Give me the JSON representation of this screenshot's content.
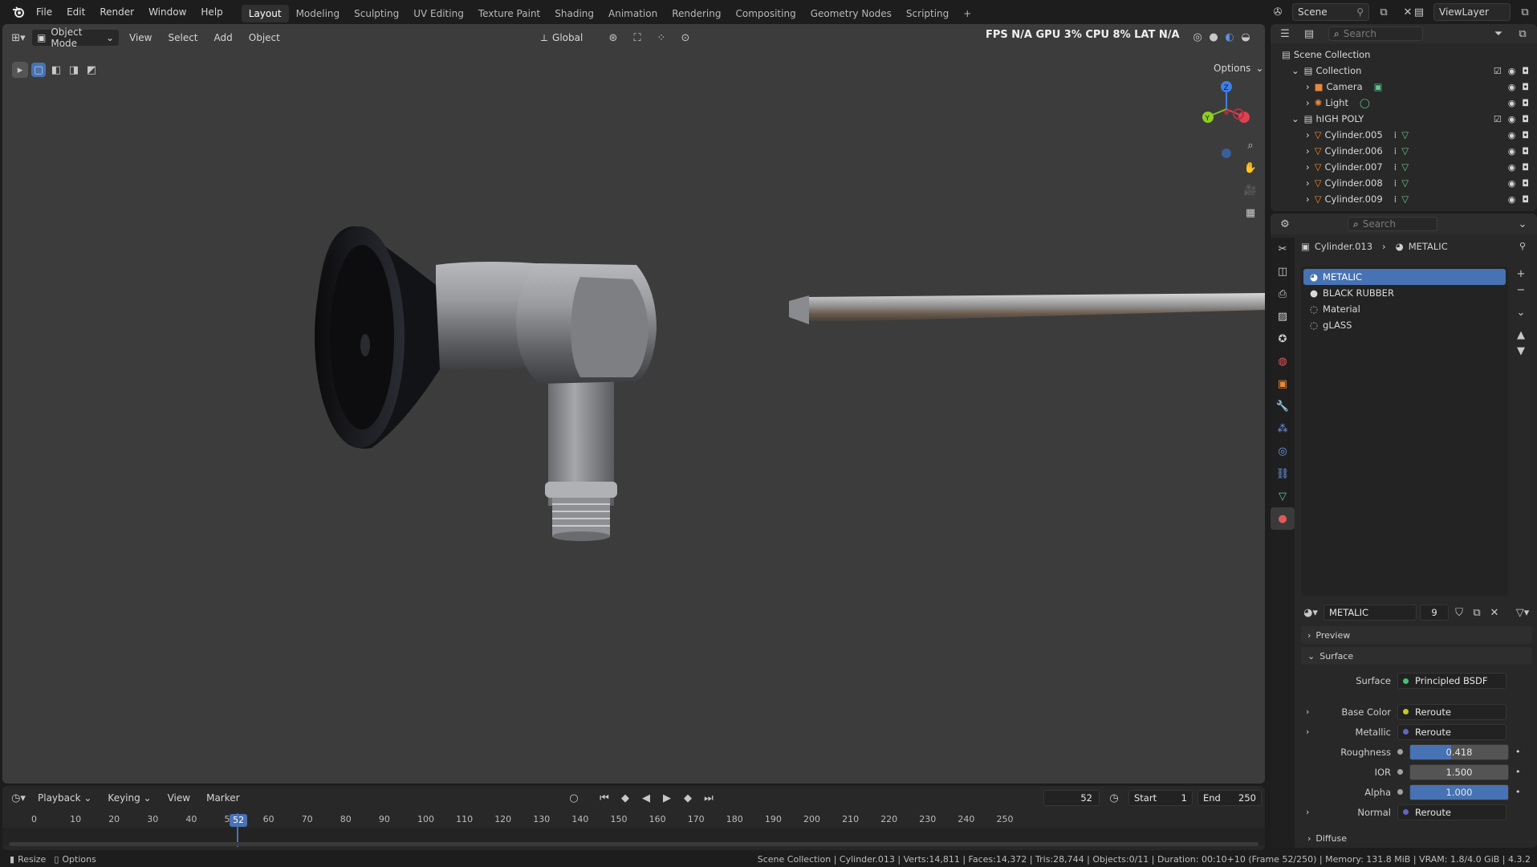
{
  "topbar": {
    "menus": [
      "File",
      "Edit",
      "Render",
      "Window",
      "Help"
    ],
    "workspaces": [
      "Layout",
      "Modeling",
      "Sculpting",
      "UV Editing",
      "Texture Paint",
      "Shading",
      "Animation",
      "Rendering",
      "Compositing",
      "Geometry Nodes",
      "Scripting"
    ],
    "active_workspace": "Layout",
    "add_tab": "+",
    "scene": "Scene",
    "view_layer": "ViewLayer"
  },
  "viewport_header": {
    "mode": "Object Mode",
    "menus": [
      "View",
      "Select",
      "Add",
      "Object"
    ],
    "orientation": "Global",
    "overlay_stats": "FPS N/A GPU 3% CPU 8% LAT N/A",
    "options": "Options"
  },
  "outliner": {
    "search_placeholder": "Search",
    "root": "Scene Collection",
    "items": [
      {
        "label": "Collection",
        "type": "collection",
        "depth": 1
      },
      {
        "label": "Camera",
        "type": "camera",
        "depth": 2
      },
      {
        "label": "Light",
        "type": "light",
        "depth": 2
      },
      {
        "label": "hIGH POLY",
        "type": "collection",
        "depth": 1
      },
      {
        "label": "Cylinder.005",
        "type": "mesh",
        "depth": 2
      },
      {
        "label": "Cylinder.006",
        "type": "mesh",
        "depth": 2
      },
      {
        "label": "Cylinder.007",
        "type": "mesh",
        "depth": 2
      },
      {
        "label": "Cylinder.008",
        "type": "mesh",
        "depth": 2
      },
      {
        "label": "Cylinder.009",
        "type": "mesh",
        "depth": 2
      }
    ]
  },
  "properties": {
    "search_placeholder": "Search",
    "breadcrumb_object": "Cylinder.013",
    "breadcrumb_material": "METALIC",
    "material_slots": [
      "METALIC",
      "BLACK RUBBER",
      "Material",
      "gLASS"
    ],
    "selected_slot": "METALIC",
    "material_name": "METALIC",
    "user_count": "9",
    "panels": {
      "preview": "Preview",
      "surface": "Surface",
      "diffuse": "Diffuse"
    },
    "surface_label": "Surface",
    "surface_value": "Principled BSDF",
    "inputs": [
      {
        "label": "Base Color",
        "value": "Reroute",
        "kind": "link",
        "dot": "#c7c729"
      },
      {
        "label": "Metallic",
        "value": "Reroute",
        "kind": "link",
        "dot": "#6363c7"
      },
      {
        "label": "Roughness",
        "value": "0.418",
        "kind": "slider",
        "fraction": 0.418,
        "dot": "#a1a1a1"
      },
      {
        "label": "IOR",
        "value": "1.500",
        "kind": "slider",
        "fraction": 0.0,
        "dot": "#a1a1a1"
      },
      {
        "label": "Alpha",
        "value": "1.000",
        "kind": "slider",
        "fraction": 1.0,
        "dot": "#a1a1a1"
      },
      {
        "label": "Normal",
        "value": "Reroute",
        "kind": "link",
        "dot": "#6363c7"
      }
    ]
  },
  "timeline": {
    "menus": [
      "Playback",
      "Keying",
      "View",
      "Marker"
    ],
    "current_frame": "52",
    "start_label": "Start",
    "start": "1",
    "end_label": "End",
    "end": "250",
    "ticks": [
      "0",
      "10",
      "20",
      "30",
      "40",
      "5",
      "60",
      "70",
      "80",
      "90",
      "100",
      "110",
      "120",
      "130",
      "140",
      "150",
      "160",
      "170",
      "180",
      "190",
      "200",
      "210",
      "220",
      "230",
      "240",
      "250"
    ]
  },
  "statusbar": {
    "left_action_1": "Resize",
    "left_action_2": "Options",
    "info": "Scene Collection | Cylinder.013 | Verts:14,811 | Faces:14,372 | Tris:28,744 | Objects:0/11 | Duration: 00:10+10 (Frame 52/250) | Memory: 131.8 MiB | VRAM: 1.8/4.0 GiB | 4.3.2"
  },
  "colors": {
    "accent": "#4772b3",
    "viewport_bg": "#3c3c3c",
    "panel_bg": "#282828",
    "mesh_icon": "#e8883a"
  }
}
